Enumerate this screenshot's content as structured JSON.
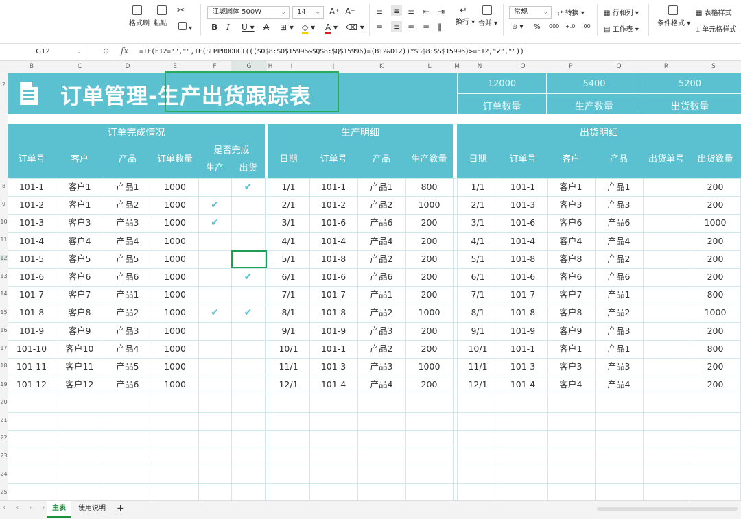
{
  "ribbon": {
    "format_painter": "格式刷",
    "paste": "粘贴",
    "font_name": "江城圆体 500W",
    "font_size": "14",
    "wrap": "换行",
    "merge": "合并",
    "number_format": "常规",
    "convert": "转换",
    "row_col": "行和列",
    "worksheet": "工作表",
    "cond_format": "条件格式",
    "table_style": "表格样式",
    "cell_style": "单元格样式"
  },
  "formula_bar": {
    "name_box": "G12",
    "fx": "fx",
    "formula": "=IF(E12=\"\",\"\",IF(SUMPRODUCT((($O$8:$O$15996&$Q$8:$Q$15996)=(B12&D12))*$S$8:$S$15996)>=E12,\"✔\",\"\"))"
  },
  "columns": [
    "B",
    "C",
    "D",
    "E",
    "F",
    "G",
    "H",
    "I",
    "J",
    "K",
    "L",
    "M",
    "N",
    "O",
    "P",
    "Q",
    "R",
    "S"
  ],
  "rows": [
    "2",
    "",
    "",
    "",
    "",
    "",
    "",
    "8",
    "9",
    "10",
    "11",
    "12",
    "13",
    "14",
    "15",
    "16",
    "17",
    "18",
    "19",
    "20",
    "21",
    "22",
    "23",
    "24",
    "25"
  ],
  "title": {
    "text_prefix": "订单管理-",
    "text_highlight": "生产出货跟踪表"
  },
  "summary": [
    {
      "value": "12000",
      "label": "订单数量"
    },
    {
      "value": "5400",
      "label": "生产数量"
    },
    {
      "value": "5200",
      "label": "出货数量"
    }
  ],
  "sections": {
    "orders": {
      "title": "订单完成情况",
      "headers": [
        "订单号",
        "客户",
        "产品",
        "订单数量"
      ],
      "done_group": "是否完成",
      "done_sub": [
        "生产",
        "出货"
      ],
      "rows": [
        [
          "101-1",
          "客户1",
          "产品1",
          "1000",
          "",
          "✔"
        ],
        [
          "101-2",
          "客户1",
          "产品2",
          "1000",
          "✔",
          ""
        ],
        [
          "101-3",
          "客户3",
          "产品3",
          "1000",
          "✔",
          ""
        ],
        [
          "101-4",
          "客户4",
          "产品4",
          "1000",
          "",
          ""
        ],
        [
          "101-5",
          "客户5",
          "产品5",
          "1000",
          "",
          ""
        ],
        [
          "101-6",
          "客户6",
          "产品6",
          "1000",
          "",
          "✔"
        ],
        [
          "101-7",
          "客户7",
          "产品1",
          "1000",
          "",
          ""
        ],
        [
          "101-8",
          "客户8",
          "产品2",
          "1000",
          "✔",
          "✔"
        ],
        [
          "101-9",
          "客户9",
          "产品3",
          "1000",
          "",
          ""
        ],
        [
          "101-10",
          "客户10",
          "产品4",
          "1000",
          "",
          ""
        ],
        [
          "101-11",
          "客户11",
          "产品5",
          "1000",
          "",
          ""
        ],
        [
          "101-12",
          "客户12",
          "产品6",
          "1000",
          "",
          ""
        ]
      ]
    },
    "production": {
      "title": "生产明细",
      "headers": [
        "日期",
        "订单号",
        "产品",
        "生产数量"
      ],
      "rows": [
        [
          "1/1",
          "101-1",
          "产品1",
          "800"
        ],
        [
          "2/1",
          "101-2",
          "产品2",
          "1000"
        ],
        [
          "3/1",
          "101-6",
          "产品6",
          "200"
        ],
        [
          "4/1",
          "101-4",
          "产品4",
          "200"
        ],
        [
          "5/1",
          "101-8",
          "产品2",
          "200"
        ],
        [
          "6/1",
          "101-6",
          "产品6",
          "200"
        ],
        [
          "7/1",
          "101-7",
          "产品1",
          "200"
        ],
        [
          "8/1",
          "101-8",
          "产品2",
          "1000"
        ],
        [
          "9/1",
          "101-9",
          "产品3",
          "200"
        ],
        [
          "10/1",
          "101-1",
          "产品2",
          "200"
        ],
        [
          "11/1",
          "101-3",
          "产品3",
          "1000"
        ],
        [
          "12/1",
          "101-4",
          "产品4",
          "200"
        ]
      ]
    },
    "shipping": {
      "title": "出货明细",
      "headers": [
        "日期",
        "订单号",
        "客户",
        "产品",
        "出货单号",
        "出货数量"
      ],
      "rows": [
        [
          "1/1",
          "101-1",
          "客户1",
          "产品1",
          "",
          "200"
        ],
        [
          "2/1",
          "101-3",
          "客户3",
          "产品3",
          "",
          "200"
        ],
        [
          "3/1",
          "101-6",
          "客户6",
          "产品6",
          "",
          "1000"
        ],
        [
          "4/1",
          "101-4",
          "客户4",
          "产品4",
          "",
          "200"
        ],
        [
          "5/1",
          "101-8",
          "客户8",
          "产品2",
          "",
          "200"
        ],
        [
          "6/1",
          "101-6",
          "客户6",
          "产品6",
          "",
          "200"
        ],
        [
          "7/1",
          "101-7",
          "客户7",
          "产品1",
          "",
          "800"
        ],
        [
          "8/1",
          "101-8",
          "客户8",
          "产品2",
          "",
          "1000"
        ],
        [
          "9/1",
          "101-9",
          "客户9",
          "产品3",
          "",
          "200"
        ],
        [
          "10/1",
          "101-1",
          "客户1",
          "产品1",
          "",
          "800"
        ],
        [
          "11/1",
          "101-3",
          "客户3",
          "产品3",
          "",
          "200"
        ],
        [
          "12/1",
          "101-4",
          "客户4",
          "产品4",
          "",
          "200"
        ]
      ]
    }
  },
  "sheets": [
    "主表",
    "使用说明"
  ],
  "colors": {
    "accent": "#5bc0cf",
    "selection": "#1e9e54",
    "tab_active": "#1b8f3a"
  }
}
